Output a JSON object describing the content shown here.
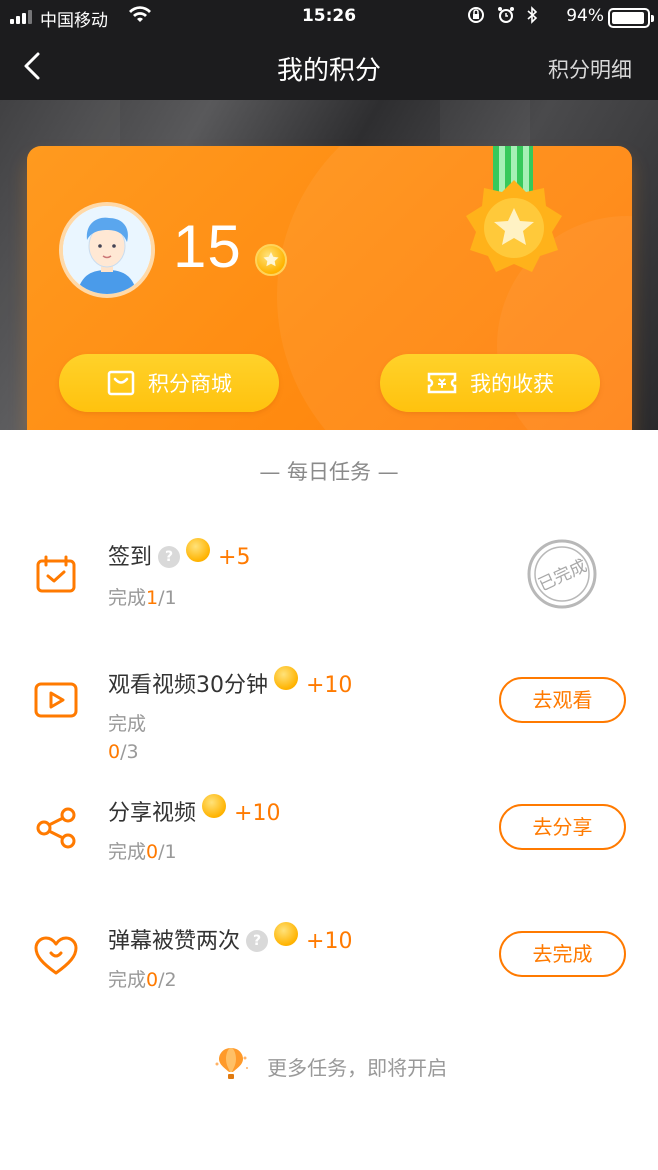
{
  "status_bar": {
    "carrier": "中国移动",
    "time": "15:26",
    "battery": "94%",
    "battery_level": 0.94
  },
  "nav": {
    "title": "我的积分",
    "detail_link": "积分明细"
  },
  "card": {
    "points": "15",
    "shop_button": "积分商城",
    "harvest_button": "我的收获"
  },
  "section_title": "— 每日任务 —",
  "tasks": [
    {
      "name": "签到",
      "reward": "+5",
      "progress_prefix": "完成",
      "progress_done": "1",
      "progress_total": "/1",
      "status": "已完成",
      "icon": "calendar-check-icon"
    },
    {
      "name": "观看视频30分钟",
      "reward": "+10",
      "progress_prefix": "完成",
      "progress_done": "0",
      "progress_total": "/3",
      "button": "去观看",
      "icon": "video-play-icon"
    },
    {
      "name": "分享视频",
      "reward": "+10",
      "progress_prefix": "完成",
      "progress_done": "0",
      "progress_total": "/1",
      "button": "去分享",
      "icon": "share-icon"
    },
    {
      "name": "弹幕被赞两次",
      "reward": "+10",
      "progress_prefix": "完成",
      "progress_done": "0",
      "progress_total": "/2",
      "button": "去完成",
      "icon": "heart-icon"
    }
  ],
  "help_mark": "?",
  "footer_text": "更多任务，即将开启",
  "colors": {
    "accent": "#ff7a00",
    "card_orange": "#ff8a10",
    "button_yellow": "#ffc20e",
    "header_dark": "#1c1c1e"
  }
}
